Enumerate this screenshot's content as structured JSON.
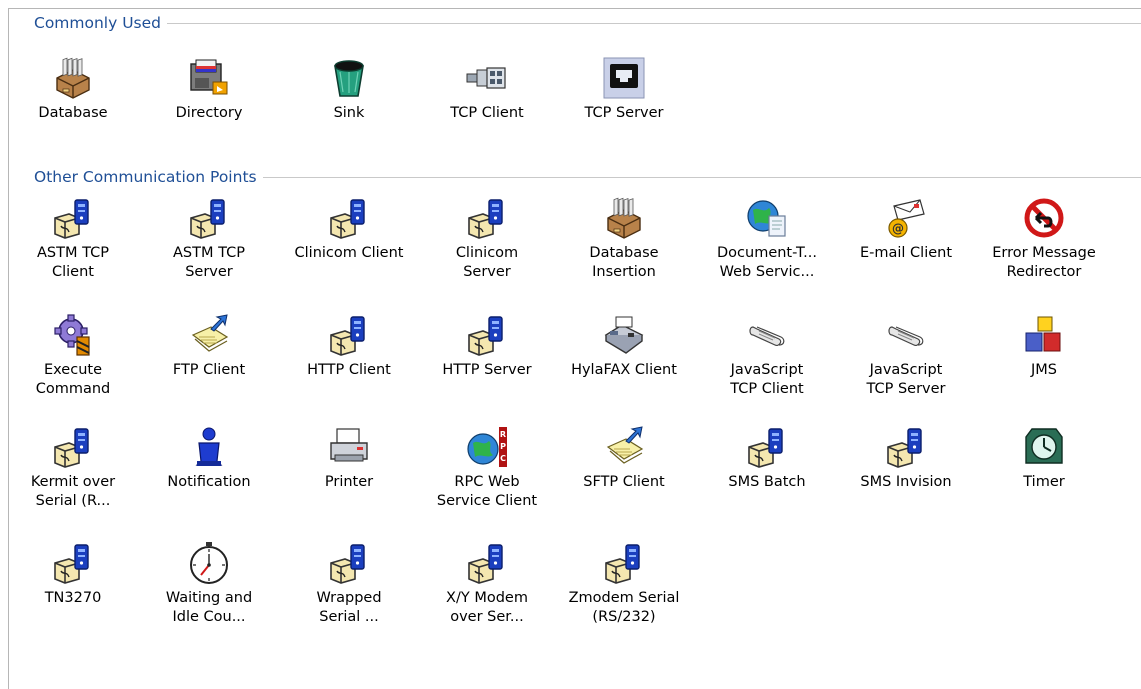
{
  "sections": [
    {
      "title": "Commonly Used",
      "items": [
        {
          "label": "Database",
          "icon": "database-icon"
        },
        {
          "label": "Directory",
          "icon": "directory-icon"
        },
        {
          "label": "Sink",
          "icon": "sink-icon"
        },
        {
          "label": "TCP Client",
          "icon": "tcp-client-icon"
        },
        {
          "label": "TCP Server",
          "icon": "tcp-server-icon"
        }
      ]
    },
    {
      "title": "Other Communication Points",
      "items": [
        {
          "label": "ASTM TCP\nClient",
          "icon": "comm-point-icon"
        },
        {
          "label": "ASTM TCP\nServer",
          "icon": "comm-point-icon"
        },
        {
          "label": "Clinicom Client",
          "icon": "comm-point-icon"
        },
        {
          "label": "Clinicom\nServer",
          "icon": "comm-point-icon"
        },
        {
          "label": "Database\nInsertion",
          "icon": "database-icon"
        },
        {
          "label": "Document-T...\nWeb Servic...",
          "icon": "web-service-icon"
        },
        {
          "label": "E-mail Client",
          "icon": "email-icon"
        },
        {
          "label": "Error Message\nRedirector",
          "icon": "no-entry-icon"
        },
        {
          "label": "Execute\nCommand",
          "icon": "gear-icon"
        },
        {
          "label": "FTP Client",
          "icon": "file-transfer-icon"
        },
        {
          "label": "HTTP Client",
          "icon": "comm-point-icon"
        },
        {
          "label": "HTTP Server",
          "icon": "comm-point-icon"
        },
        {
          "label": "HylaFAX Client",
          "icon": "fax-icon"
        },
        {
          "label": "JavaScript\nTCP Client",
          "icon": "scroll-icon"
        },
        {
          "label": "JavaScript\nTCP Server",
          "icon": "scroll-icon"
        },
        {
          "label": "JMS",
          "icon": "blocks-icon"
        },
        {
          "label": "Kermit over\nSerial (R...",
          "icon": "comm-point-icon"
        },
        {
          "label": "Notification",
          "icon": "user-icon"
        },
        {
          "label": "Printer",
          "icon": "printer-icon"
        },
        {
          "label": "RPC Web\nService Client",
          "icon": "globe-rpc-icon"
        },
        {
          "label": "SFTP Client",
          "icon": "file-transfer-icon"
        },
        {
          "label": "SMS Batch",
          "icon": "comm-point-icon"
        },
        {
          "label": "SMS Invision",
          "icon": "comm-point-icon"
        },
        {
          "label": "Timer",
          "icon": "clock-icon"
        },
        {
          "label": "TN3270",
          "icon": "comm-point-icon"
        },
        {
          "label": "Waiting and\nIdle Cou...",
          "icon": "stopwatch-icon"
        },
        {
          "label": "Wrapped\nSerial ...",
          "icon": "comm-point-icon"
        },
        {
          "label": "X/Y Modem\nover Ser...",
          "icon": "comm-point-icon"
        },
        {
          "label": "Zmodem Serial\n(RS/232)",
          "icon": "comm-point-icon"
        }
      ]
    }
  ]
}
